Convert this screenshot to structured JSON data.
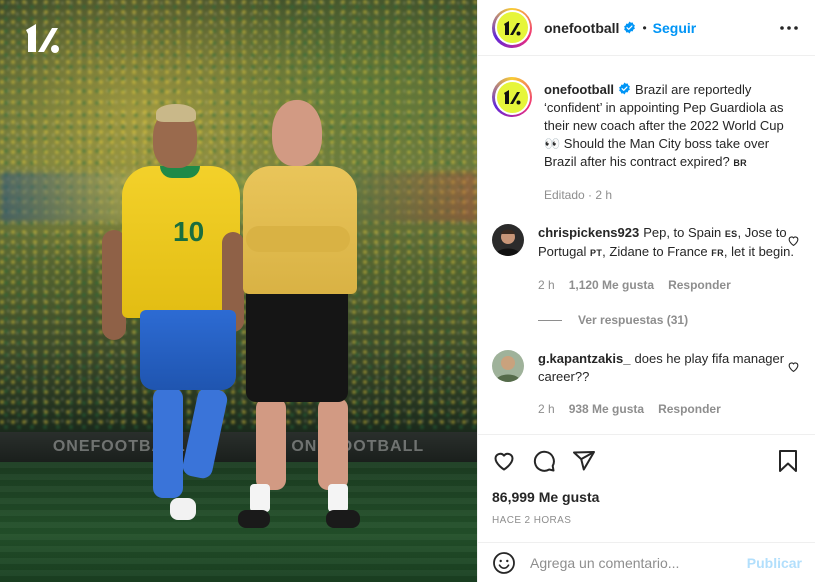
{
  "image": {
    "brand_watermark": "ONEFOOTBALL",
    "jersey_number": "10",
    "logo_icon": "onefootball-logo-icon"
  },
  "header": {
    "username": "onefootball",
    "separator": "•",
    "follow_label": "Seguir",
    "more_icon": "more-horizontal-icon"
  },
  "caption": {
    "username": "onefootball",
    "text": "Brazil are reportedly ‘confident’ in appointing Pep Guardiola as their new coach after the 2022 World Cup 👀 Should the Man City boss take over Brazil after his contract expired?",
    "flag": "BR",
    "meta": "Editado · 2 h"
  },
  "comments": [
    {
      "username": "chrispickens923",
      "segments": [
        "Pep, to Spain",
        "ES",
        ", Jose to Portugal",
        "PT",
        ", Zidane to France",
        "FR",
        ", let it begin."
      ],
      "time": "2 h",
      "likes": "1,120 Me gusta",
      "reply": "Responder",
      "view_replies": "Ver respuestas (31)"
    },
    {
      "username": "g.kapantzakis_",
      "text": "does he play fifa manager career??",
      "time": "2 h",
      "likes": "938 Me gusta",
      "reply": "Responder"
    }
  ],
  "actions": {
    "likes": "86,999 Me gusta",
    "posted": "HACE 2 HORAS"
  },
  "add_comment": {
    "placeholder": "Agrega un comentario...",
    "publish_label": "Publicar"
  },
  "colors": {
    "accent": "#0095f6",
    "publish_disabled": "#b2dffc",
    "muted": "#8e8e8e",
    "logo_yellow": "#e6f53a"
  }
}
